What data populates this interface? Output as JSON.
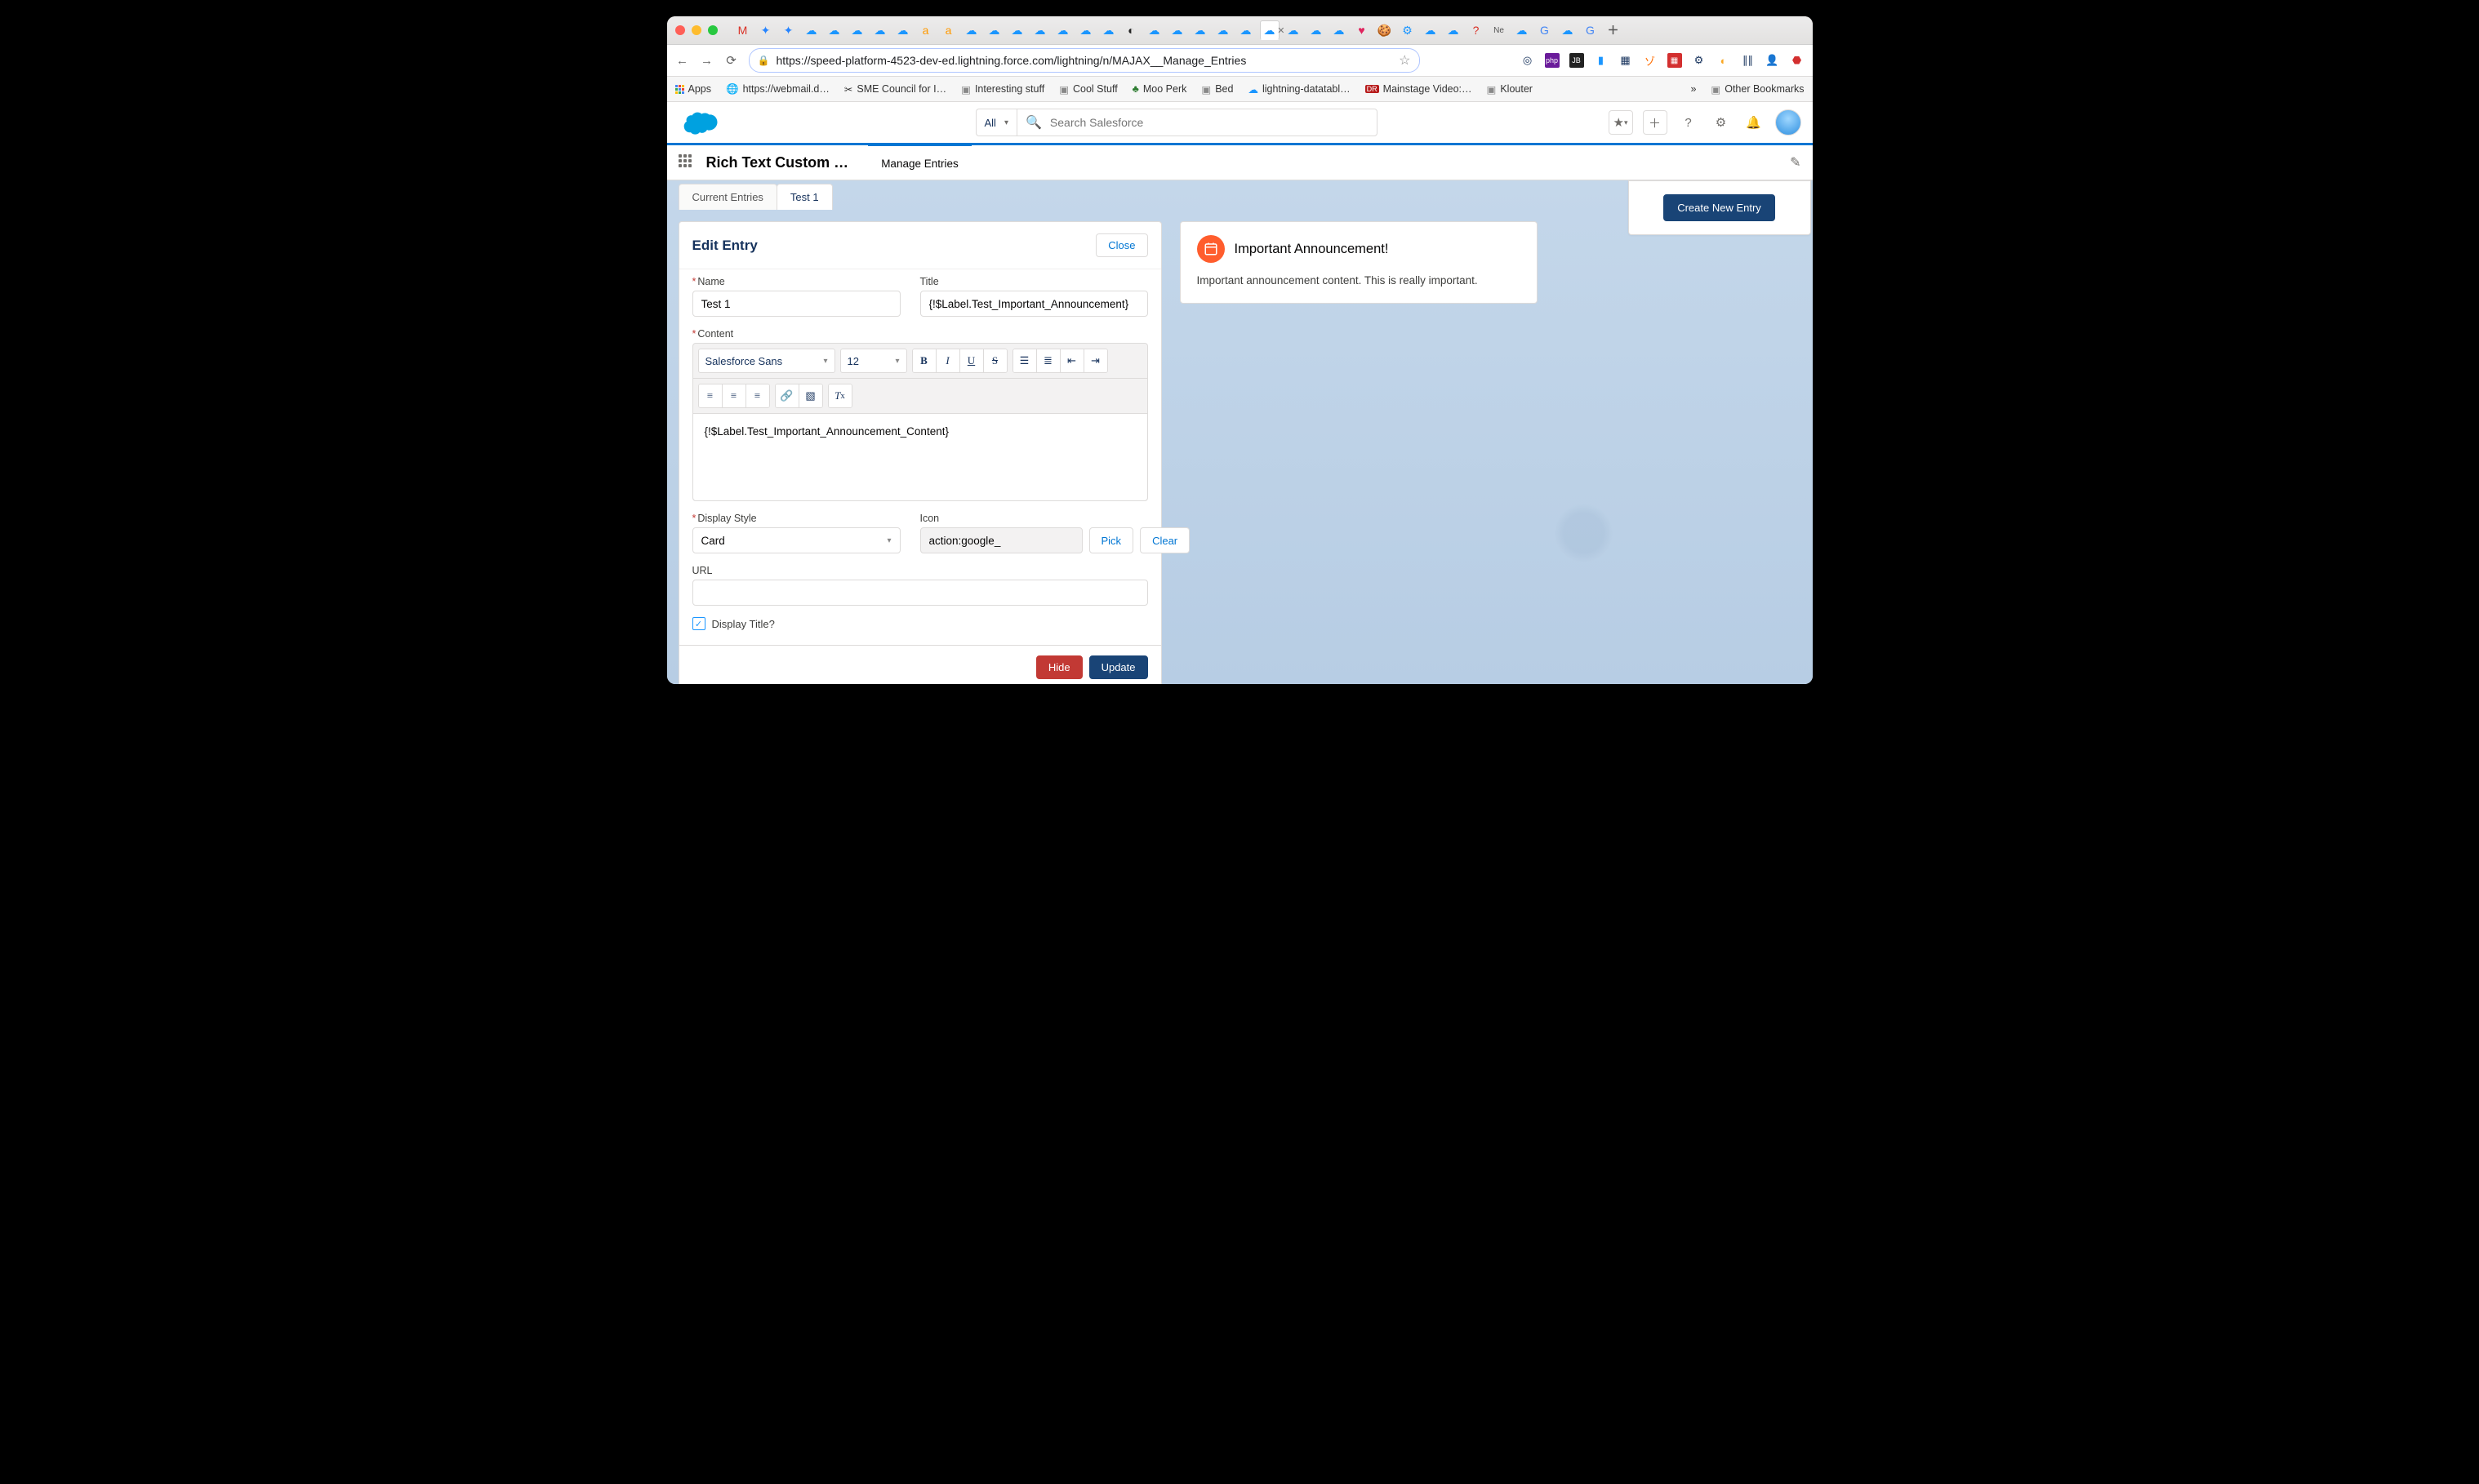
{
  "browser": {
    "url": "https://speed-platform-4523-dev-ed.lightning.force.com/lightning/n/MAJAX__Manage_Entries",
    "bookmarks": [
      "Apps",
      "https://webmail.d…",
      "SME Council for I…",
      "Interesting stuff",
      "Cool Stuff",
      "Moo Perk",
      "Bed",
      "lightning-datatabl…",
      "Mainstage Video:…",
      "Klouter"
    ],
    "overflow": "»",
    "other_bookmarks": "Other Bookmarks"
  },
  "header": {
    "scope": "All",
    "search_placeholder": "Search Salesforce"
  },
  "app": {
    "name": "Rich Text Custom …",
    "nav_tabs": [
      "Manage Entries"
    ]
  },
  "subtabs": {
    "items": [
      "Current Entries",
      "Test 1"
    ],
    "active": 1
  },
  "edit": {
    "heading": "Edit Entry",
    "close": "Close",
    "labels": {
      "name": "Name",
      "title": "Title",
      "content": "Content",
      "display_style": "Display Style",
      "icon": "Icon",
      "url": "URL",
      "display_title": "Display Title?"
    },
    "values": {
      "name": "Test 1",
      "title": "{!$Label.Test_Important_Announcement}",
      "content": "{!$Label.Test_Important_Announcement_Content}",
      "display_style": "Card",
      "icon": "action:google_",
      "url": "",
      "display_title": true
    },
    "rte": {
      "font": "Salesforce Sans",
      "size": "12"
    },
    "buttons": {
      "pick": "Pick",
      "clear": "Clear",
      "hide": "Hide",
      "update": "Update"
    }
  },
  "preview": {
    "title": "Important Announcement!",
    "body": "Important announcement content. This is really important."
  },
  "sidebar": {
    "create": "Create New Entry"
  }
}
